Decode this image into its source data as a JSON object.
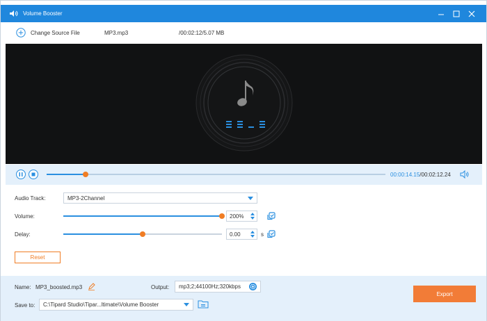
{
  "window": {
    "title": "Volume Booster"
  },
  "source": {
    "change_label": "Change Source File",
    "file_name": "MP3.mp3",
    "file_info": "/00:02:12/5.07 MB"
  },
  "player": {
    "current_time": "00:00:14.15",
    "separator": "/",
    "total_time": "00:02:12.24",
    "progress": 0.115
  },
  "settings": {
    "audio_track_label": "Audio Track:",
    "audio_track_value": "MP3-2Channel",
    "volume_label": "Volume:",
    "volume_value": "200%",
    "volume_level": 1.0,
    "delay_label": "Delay:",
    "delay_value": "0.00",
    "delay_unit": "s",
    "delay_level": 0.5,
    "reset_label": "Reset"
  },
  "output": {
    "name_label": "Name:",
    "name_value": "MP3_boosted.mp3",
    "output_label": "Output:",
    "output_value": "mp3;2;44100Hz;320kbps",
    "save_label": "Save to:",
    "save_path": "C:\\Tipard Studio\\Tipar...ltimate\\Volume Booster",
    "export_label": "Export"
  },
  "colors": {
    "titlebar": "#1f87dd",
    "accent": "#2a8fe0",
    "orange": "#f07d24",
    "export": "#f27c37"
  }
}
